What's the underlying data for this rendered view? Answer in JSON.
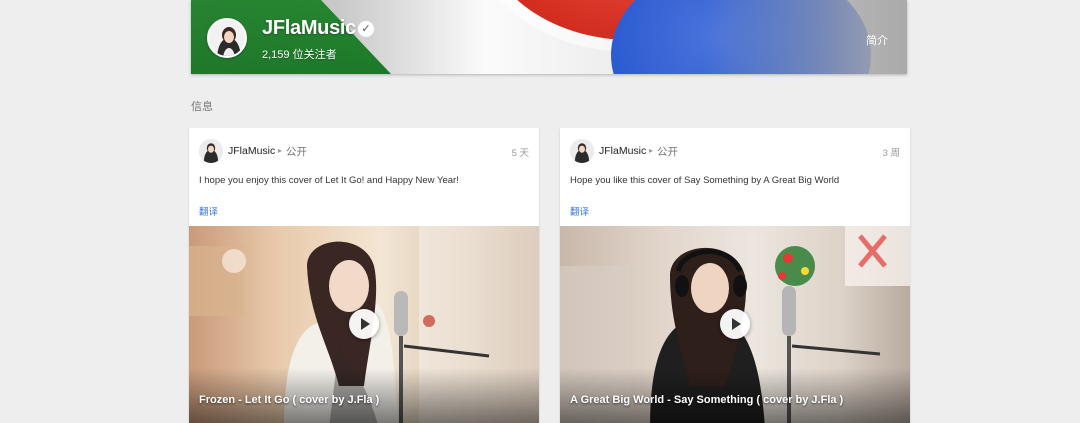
{
  "channel": {
    "name": "JFlaMusic",
    "followers": "2,159 位关注者",
    "about_label": "简介"
  },
  "section": {
    "label": "信息"
  },
  "posts": [
    {
      "author": "JFlaMusic",
      "visibility": "公开",
      "time": "5 天",
      "text": "I hope you enjoy this cover of Let It Go! and Happy New Year!",
      "translate_label": "翻译",
      "video_title": "Frozen - Let It Go ( cover by J.Fla )"
    },
    {
      "author": "JFlaMusic",
      "visibility": "公开",
      "time": "3 周",
      "text": "Hope you like this cover of Say Something by A Great Big World",
      "translate_label": "翻译",
      "video_title": "A Great Big World - Say Something ( cover by J.Fla )"
    }
  ],
  "colors": {
    "link": "#3b78e7",
    "banner_green": "#2e9a3a",
    "banner_red": "#d62d20",
    "banner_blue": "#2a5bd7",
    "page_background": "#eeeeee"
  },
  "icons": {
    "verified": "verified-check-icon",
    "play": "play-icon",
    "arrow": "arrow-right-icon"
  }
}
